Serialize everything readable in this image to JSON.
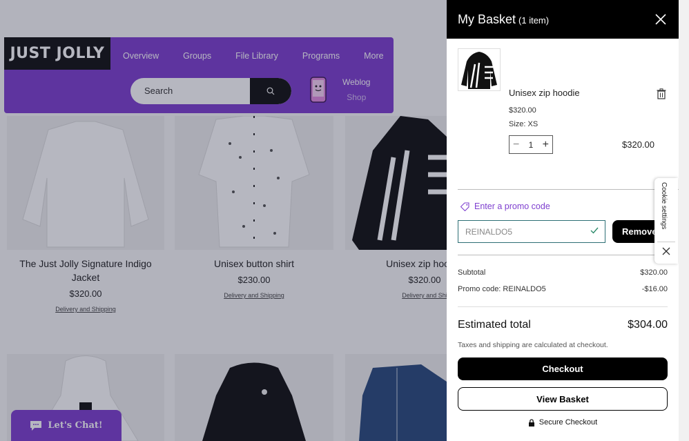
{
  "store": {
    "logo": "JUST JOLLY",
    "nav": [
      "Overview",
      "Groups",
      "File Library",
      "Programs",
      "More"
    ],
    "search_placeholder": "Search",
    "sub_links": [
      "Weblog",
      "Shop"
    ],
    "products": [
      {
        "name": "The Just Jolly Signature Indigo Jacket",
        "price": "$320.00",
        "shipping": "Delivery and Shipping"
      },
      {
        "name": "Unisex button shirt",
        "price": "$230.00",
        "shipping": "Delivery and Shipping"
      },
      {
        "name": "Unisex zip hoo",
        "price": "$320.00",
        "shipping": "Delivery and Shipp"
      }
    ],
    "chat_label": "Let's Chat!"
  },
  "basket": {
    "title": "My Basket",
    "count": "(1 item)",
    "item": {
      "name": "Unisex zip hoodie",
      "price": "$320.00",
      "size": "Size: XS",
      "quantity": "1",
      "total": "$320.00"
    },
    "promo_link": "Enter a promo code",
    "promo_value": "REINALDO5",
    "remove_label": "Remove",
    "subtotal_label": "Subtotal",
    "subtotal_value": "$320.00",
    "promo_label": "Promo code: REINALDO5",
    "promo_discount": "-$16.00",
    "estimated_label": "Estimated total",
    "estimated_value": "$304.00",
    "taxes_note": "Taxes and shipping are calculated at checkout.",
    "checkout_label": "Checkout",
    "view_basket_label": "View Basket",
    "secure_label": "Secure Checkout"
  },
  "cookie_label": "Cookie settings",
  "colors": {
    "brand_purple": "#7e3fcf",
    "promo_border": "#2c6e74"
  }
}
